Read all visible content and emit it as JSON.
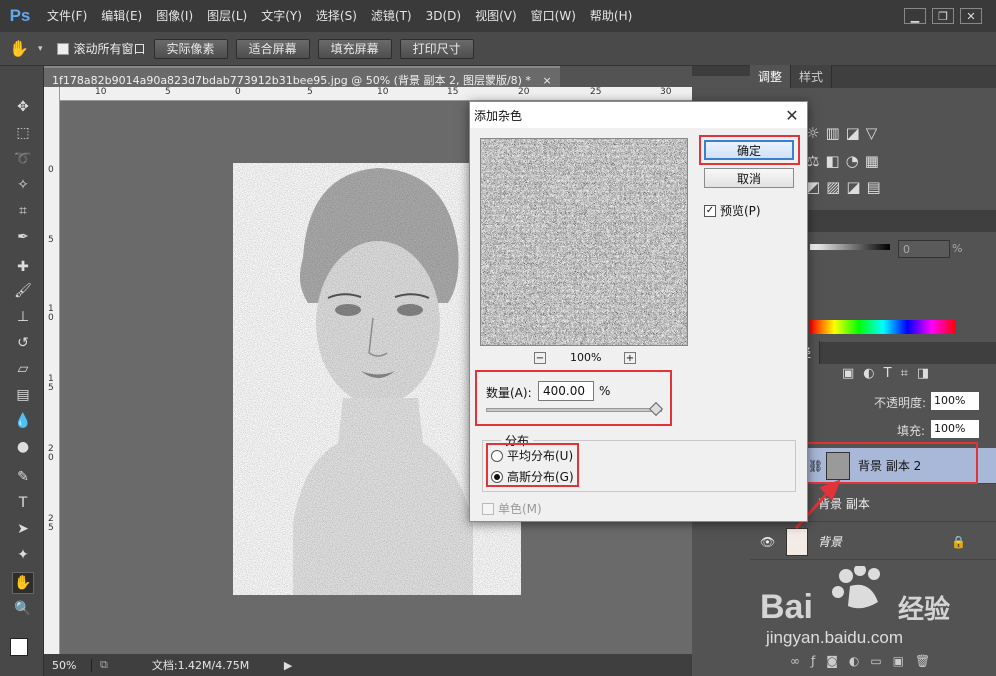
{
  "app": {
    "logo": "Ps"
  },
  "menu": [
    "文件(F)",
    "编辑(E)",
    "图像(I)",
    "图层(L)",
    "文字(Y)",
    "选择(S)",
    "滤镜(T)",
    "3D(D)",
    "视图(V)",
    "窗口(W)",
    "帮助(H)"
  ],
  "window_controls": {
    "minimize": "▁",
    "restore": "❐",
    "close": "✕"
  },
  "options": {
    "scroll_all": "滚动所有窗口",
    "actual_pixels": "实际像素",
    "fit_screen": "适合屏幕",
    "fill_screen": "填充屏幕",
    "print_size": "打印尺寸"
  },
  "document": {
    "tab_title": "1f178a82b9014a90a823d7bdab773912b31bee95.jpg @ 50% (背景 副本 2, 图层蒙版/8) *",
    "tab_close": "×",
    "ruler_h": [
      "10",
      "5",
      "0",
      "5",
      "10",
      "15",
      "20",
      "25",
      "30"
    ],
    "ruler_v": [
      "0",
      "5",
      "1 0",
      "1 5",
      "2 0",
      "2 5"
    ]
  },
  "status": {
    "zoom": "50%",
    "doc": "文档:1.42M/4.75M"
  },
  "dialog": {
    "title": "添加杂色",
    "close": "✕",
    "ok": "确定",
    "cancel": "取消",
    "preview_label": "预览(P)",
    "preview_checked": true,
    "zoom_level": "100%",
    "zoom_out": "−",
    "zoom_in": "+",
    "amount_label": "数量(A):",
    "amount_value": "400.00",
    "amount_unit": "%",
    "amount_slider_pct": 100,
    "distribution_label": "分布",
    "uniform": "平均分布(U)",
    "gaussian": "高斯分布(G)",
    "selected_distribution": "gaussian",
    "monochrome": "单色(M)"
  },
  "panels": {
    "adjust_tabs": [
      "调整",
      "样式"
    ],
    "color_tab": "板",
    "color_value": "0",
    "color_unit": "%",
    "layers_tabs": [
      "道",
      "路径"
    ],
    "opacity_label": "不透明度:",
    "opacity_value": "100%",
    "fill_label": "填充:",
    "fill_value": "100%",
    "layers": [
      {
        "name": "背景 副本 2",
        "selected": true
      },
      {
        "name": "背景 副本",
        "selected": false
      },
      {
        "name": "背景",
        "selected": false
      }
    ]
  },
  "watermark": {
    "brand": "Bai du 经验",
    "url": "jingyan.baidu.com"
  },
  "colors": {
    "accent_red": "#e2333a",
    "selected_layer": "#a9b8d8",
    "ps_blue": "#5fa8f4"
  }
}
